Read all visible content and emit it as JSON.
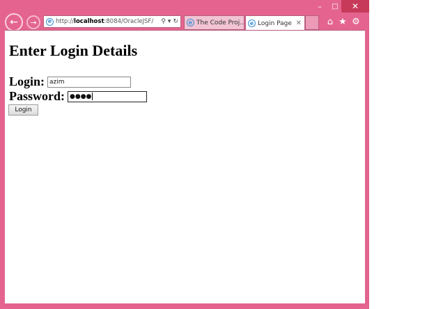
{
  "window": {
    "controls": {
      "minimize": "–",
      "maximize": "□",
      "close": "✕"
    }
  },
  "nav": {
    "back_icon": "←",
    "forward_icon": "→",
    "address": {
      "prefix": "http://",
      "host": "localhost",
      "rest": ":8084/OracleJSF/"
    },
    "address_icons": {
      "search": "⚲",
      "dropdown": "▾",
      "refresh": "↻"
    }
  },
  "tabs": [
    {
      "label": "The Code Proj...",
      "active": false
    },
    {
      "label": "Login Page",
      "active": true,
      "close": "✕"
    }
  ],
  "toolbar_icons": {
    "home": "⌂",
    "favorites": "★",
    "settings": "⚙"
  },
  "page": {
    "title": "Enter Login Details",
    "login_label": "Login:",
    "login_value": "azim",
    "password_label": "Password:",
    "password_value": "●●●●",
    "submit_label": "Login"
  },
  "colors": {
    "chrome": "#e4648f",
    "close_button": "#c73a5a",
    "ie_icon": "#3b8fd6"
  }
}
